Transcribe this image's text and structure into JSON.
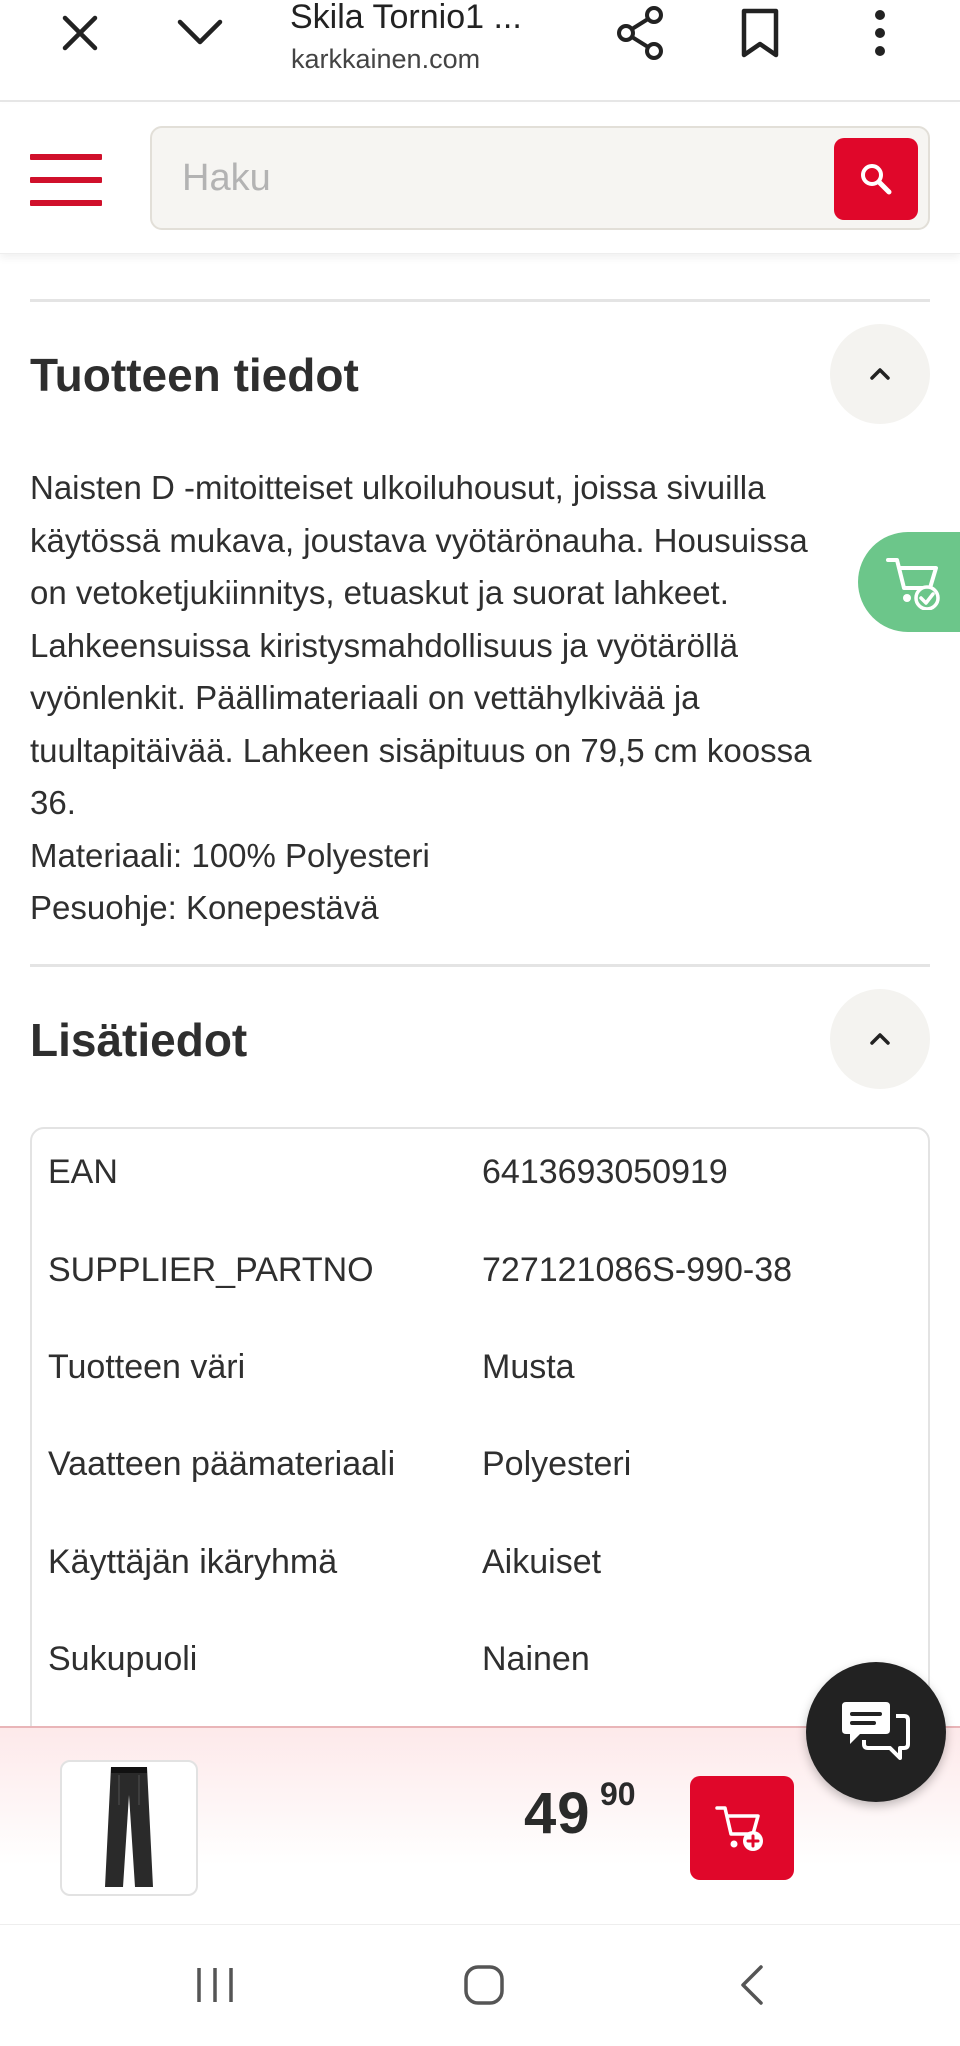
{
  "browser": {
    "page_title": "Skila Tornio1 ...",
    "url": "karkkainen.com",
    "icons": [
      "close-icon",
      "chevron-down-icon",
      "share-icon",
      "bookmark-icon",
      "more-vert-icon"
    ]
  },
  "header": {
    "search_placeholder": "Haku",
    "icons": [
      "hamburger-menu-icon",
      "search-icon"
    ],
    "brand_color": "#e0072a"
  },
  "product_details": {
    "title": "Tuotteen tiedot",
    "lines": [
      "Naisten D -mitoitteiset ulkoiluhousut, joissa sivuilla",
      "käytössä mukava, joustava vyötärönauha. Housuissa",
      "on vetoketjukiinnitys, etuaskut ja suorat lahkeet.",
      "Lahkeensuissa kiristysmahdollisuus ja vyötäröllä",
      "vyönlenkit. Päällimateriaali on vettähylkivää ja",
      "tuultapitäivää. Lahkeen sisäpituus on 79,5 cm koossa",
      "36.",
      "Materiaali: 100% Polyesteri",
      "Pesuohje: Konepestävä"
    ]
  },
  "additional_info": {
    "title": "Lisätiedot",
    "rows": [
      {
        "key": "EAN",
        "value": "6413693050919"
      },
      {
        "key": "SUPPLIER_PARTNO",
        "value": "727121086S-990-38"
      },
      {
        "key": "Tuotteen väri",
        "value": "Musta"
      },
      {
        "key": "Vaatteen päämateriaali",
        "value": "Polyesteri"
      },
      {
        "key": "Käyttäjän ikäryhmä",
        "value": "Aikuiset"
      },
      {
        "key": "Sukupuoli",
        "value": "Nainen"
      }
    ]
  },
  "sticky_bar": {
    "price_euros": "49",
    "price_cents": "90",
    "icons": [
      "product-thumbnail",
      "add-to-cart-icon",
      "chat-icon"
    ]
  },
  "floating_cart": {
    "icon": "cart-check-icon",
    "color": "#6cc68a"
  },
  "system_nav": {
    "icons": [
      "recent-apps-icon",
      "home-icon",
      "back-icon"
    ]
  }
}
